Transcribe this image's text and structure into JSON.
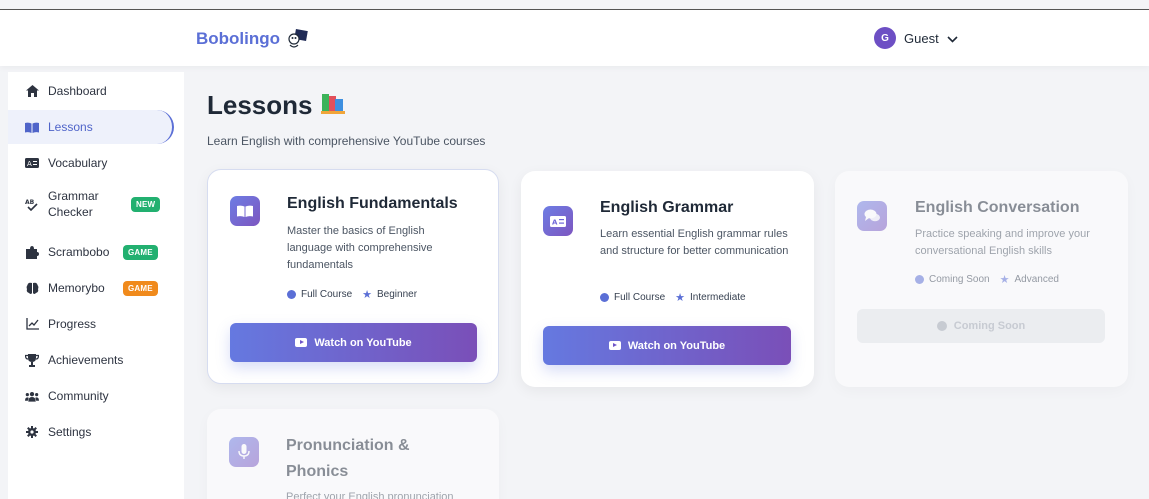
{
  "header": {
    "brand": "Bobolingo",
    "user_initial": "G",
    "user_name": "Guest"
  },
  "sidebar": {
    "items": [
      {
        "label": "Dashboard",
        "icon": "home-icon"
      },
      {
        "label": "Lessons",
        "icon": "book-icon",
        "active": true
      },
      {
        "label": "Vocabulary",
        "icon": "vocabulary-icon"
      },
      {
        "label": "Grammar Checker",
        "icon": "spellcheck-icon",
        "badge": "NEW"
      },
      {
        "label": "Scrambobo",
        "icon": "puzzle-icon",
        "badge": "GAME"
      },
      {
        "label": "Memorybo",
        "icon": "brain-icon",
        "badge": "GAME"
      },
      {
        "label": "Progress",
        "icon": "chart-line-icon"
      },
      {
        "label": "Achievements",
        "icon": "trophy-icon"
      },
      {
        "label": "Community",
        "icon": "users-icon"
      },
      {
        "label": "Settings",
        "icon": "gear-icon"
      }
    ]
  },
  "page": {
    "title": "Lessons",
    "subtitle": "Learn English with comprehensive YouTube courses"
  },
  "lessons": [
    {
      "title": "English Fundamentals",
      "description": "Master the basics of English language with comprehensive fundamentals",
      "type": "Full Course",
      "level": "Beginner",
      "button": "Watch on YouTube",
      "icon": "book-open-icon"
    },
    {
      "title": "English Grammar",
      "description": "Learn essential English grammar rules and structure for better communication",
      "type": "Full Course",
      "level": "Intermediate",
      "button": "Watch on YouTube",
      "icon": "language-icon"
    },
    {
      "title": "English Conversation",
      "description": "Practice speaking and improve your conversational English skills",
      "type": "Coming Soon",
      "level": "Advanced",
      "button": "Coming Soon",
      "icon": "comments-icon"
    },
    {
      "title": "Pronunciation & Phonics",
      "description": "Perfect your English pronunciation",
      "icon": "microphone-icon"
    }
  ],
  "colors": {
    "accent": "#5b6fd6",
    "new_badge": "#22b070",
    "game_badge_orange": "#f08a1c"
  }
}
